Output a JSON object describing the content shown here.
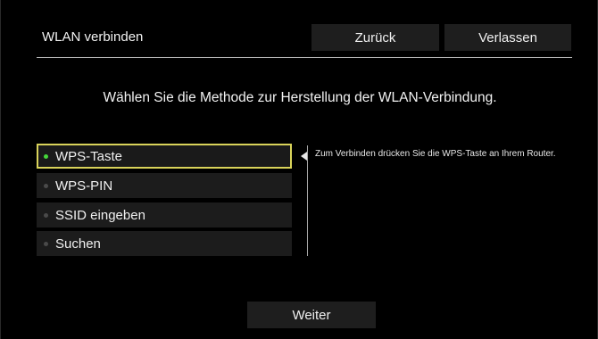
{
  "header": {
    "title": "WLAN verbinden",
    "back_label": "Zurück",
    "exit_label": "Verlassen"
  },
  "prompt": "Wählen Sie die Methode zur Herstellung der WLAN-Verbindung.",
  "options": [
    {
      "label": "WPS-Taste",
      "selected": true
    },
    {
      "label": "WPS-PIN",
      "selected": false
    },
    {
      "label": "SSID eingeben",
      "selected": false
    },
    {
      "label": "Suchen",
      "selected": false
    }
  ],
  "help_text": "Zum Verbinden drücken Sie die WPS-Taste an Ihrem Router.",
  "footer": {
    "next_label": "Weiter"
  },
  "colors": {
    "selection_border": "#d9d35a",
    "selected_dot": "#45d63a",
    "button_bg": "#1e1e1e"
  }
}
